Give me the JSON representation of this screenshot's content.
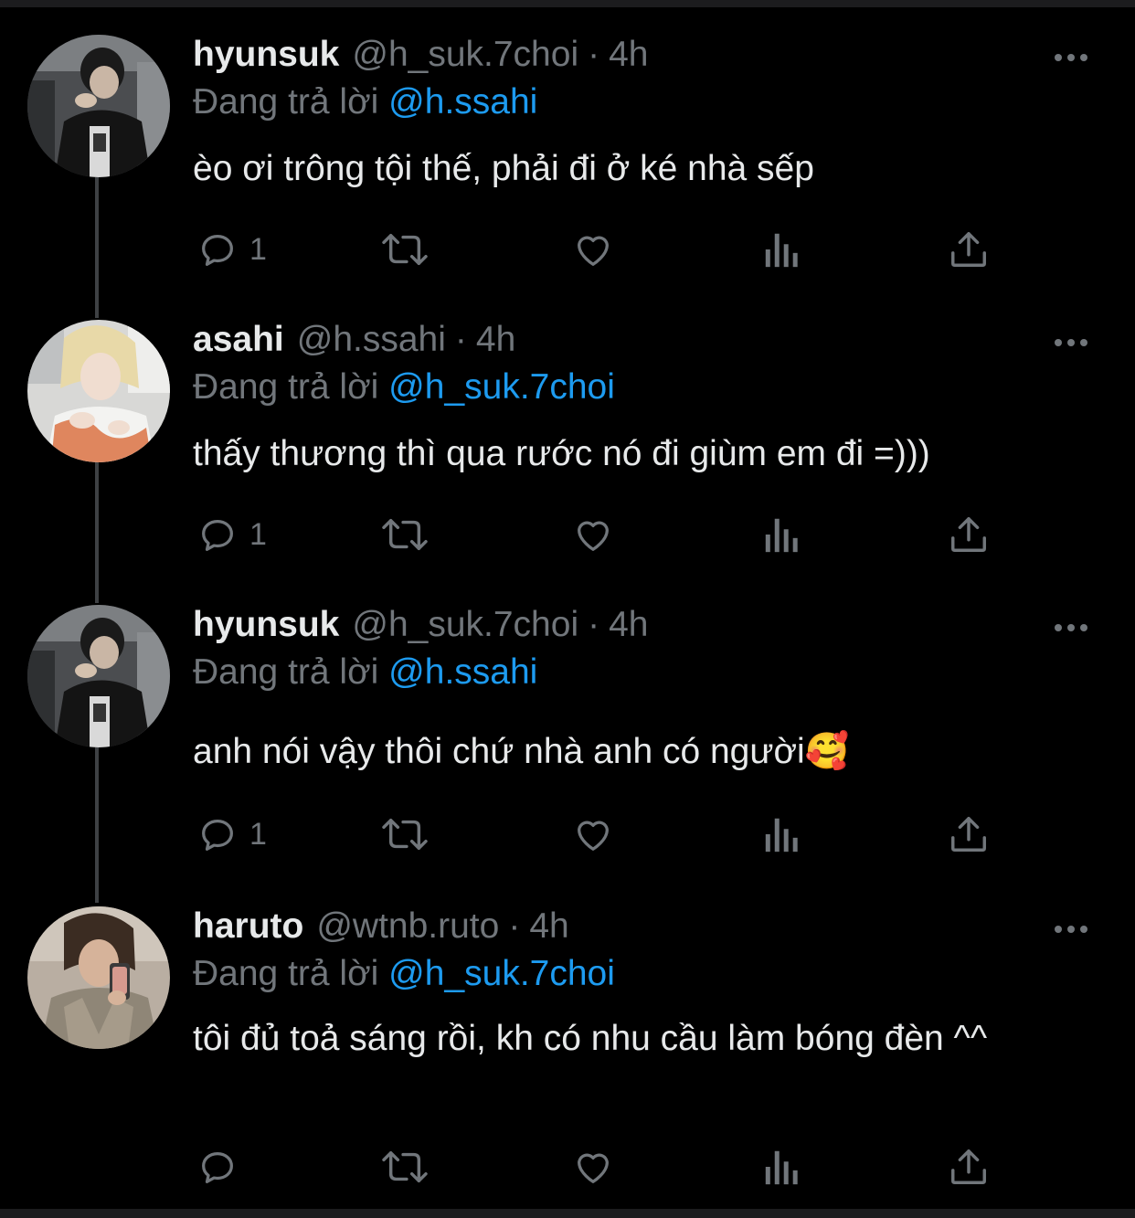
{
  "reply_prefix": "Đang trả lời",
  "colors": {
    "background": "#000000",
    "text": "#e7e9ea",
    "muted": "#71767b",
    "mention": "#1d9bf0",
    "thread_line": "#3e4144"
  },
  "tweets": [
    {
      "name": "hyunsuk",
      "handle": "@h_suk.7choi",
      "dot": "·",
      "time": "4h",
      "reply_to": "@h.ssahi",
      "text": "èo ơi trông tội thế, phải đi ở ké nhà sếp",
      "reply_count": "1",
      "avatar": "avatar-hyunsuk"
    },
    {
      "name": "asahi",
      "handle": "@h.ssahi",
      "dot": "·",
      "time": "4h",
      "reply_to": "@h_suk.7choi",
      "text": "thấy thương thì qua rước nó đi giùm em đi =)))",
      "reply_count": "1",
      "avatar": "avatar-asahi"
    },
    {
      "name": "hyunsuk",
      "handle": "@h_suk.7choi",
      "dot": "·",
      "time": "4h",
      "reply_to": "@h.ssahi",
      "text": "anh nói vậy thôi chứ nhà anh có người🥰",
      "reply_count": "1",
      "avatar": "avatar-hyunsuk"
    },
    {
      "name": "haruto",
      "handle": "@wtnb.ruto",
      "dot": "·",
      "time": "4h",
      "reply_to": "@h_suk.7choi",
      "text": "tôi đủ toả sáng rồi, kh có nhu cầu làm bóng đèn ^^",
      "reply_count": "",
      "avatar": "avatar-haruto"
    }
  ]
}
